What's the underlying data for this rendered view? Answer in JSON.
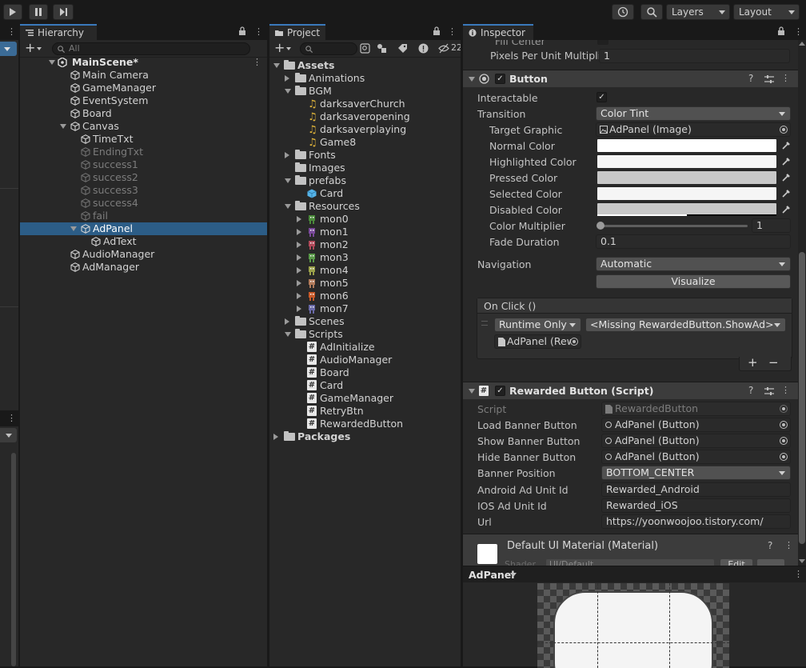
{
  "toolbar": {
    "layers_label": "Layers",
    "layout_label": "Layout"
  },
  "hierarchy": {
    "tab_label": "Hierarchy",
    "search_placeholder": "All",
    "scene_name": "MainScene*",
    "items": [
      {
        "label": "Main Camera",
        "depth": 1,
        "dim": false
      },
      {
        "label": "GameManager",
        "depth": 1,
        "dim": false
      },
      {
        "label": "EventSystem",
        "depth": 1,
        "dim": false
      },
      {
        "label": "Board",
        "depth": 1,
        "dim": false
      },
      {
        "label": "Canvas",
        "depth": 1,
        "dim": false
      },
      {
        "label": "TimeTxt",
        "depth": 2,
        "dim": false
      },
      {
        "label": "EndingTxt",
        "depth": 2,
        "dim": true
      },
      {
        "label": "success1",
        "depth": 2,
        "dim": true
      },
      {
        "label": "success2",
        "depth": 2,
        "dim": true
      },
      {
        "label": "success3",
        "depth": 2,
        "dim": true
      },
      {
        "label": "success4",
        "depth": 2,
        "dim": true
      },
      {
        "label": "fail",
        "depth": 2,
        "dim": true
      },
      {
        "label": "AdPanel",
        "depth": 2,
        "dim": false
      },
      {
        "label": "AdText",
        "depth": 3,
        "dim": false
      },
      {
        "label": "AudioManager",
        "depth": 1,
        "dim": false
      },
      {
        "label": "AdManager",
        "depth": 1,
        "dim": false
      }
    ]
  },
  "project": {
    "tab_label": "Project",
    "hidden_count": "22",
    "items": [
      {
        "label": "Assets",
        "kind": "root"
      },
      {
        "label": "Animations",
        "kind": "folder"
      },
      {
        "label": "BGM",
        "kind": "folder"
      },
      {
        "label": "darksaverChurch",
        "kind": "audio"
      },
      {
        "label": "darksaveropening",
        "kind": "audio"
      },
      {
        "label": "darksaverplaying",
        "kind": "audio"
      },
      {
        "label": "Game8",
        "kind": "audio"
      },
      {
        "label": "Fonts",
        "kind": "folder"
      },
      {
        "label": "Images",
        "kind": "folder"
      },
      {
        "label": "prefabs",
        "kind": "folder"
      },
      {
        "label": "Card",
        "kind": "prefab"
      },
      {
        "label": "Resources",
        "kind": "folder"
      },
      {
        "label": "mon0",
        "kind": "sprite"
      },
      {
        "label": "mon1",
        "kind": "sprite"
      },
      {
        "label": "mon2",
        "kind": "sprite"
      },
      {
        "label": "mon3",
        "kind": "sprite"
      },
      {
        "label": "mon4",
        "kind": "sprite"
      },
      {
        "label": "mon5",
        "kind": "sprite"
      },
      {
        "label": "mon6",
        "kind": "sprite"
      },
      {
        "label": "mon7",
        "kind": "sprite"
      },
      {
        "label": "Scenes",
        "kind": "folder"
      },
      {
        "label": "Scripts",
        "kind": "folder"
      },
      {
        "label": "AdInitialize",
        "kind": "script"
      },
      {
        "label": "AudioManager",
        "kind": "script"
      },
      {
        "label": "Board",
        "kind": "script"
      },
      {
        "label": "Card",
        "kind": "script"
      },
      {
        "label": "GameManager",
        "kind": "script"
      },
      {
        "label": "RetryBtn",
        "kind": "script"
      },
      {
        "label": "RewardedButton",
        "kind": "script"
      },
      {
        "label": "Packages",
        "kind": "root"
      }
    ]
  },
  "inspector": {
    "tab_label": "Inspector",
    "cut_label": "Fill Center",
    "pixels_per_unit_label": "Pixels Per Unit Multiplie",
    "pixels_per_unit_value": "1",
    "button": {
      "title": "Button",
      "interactable_label": "Interactable",
      "transition_label": "Transition",
      "transition_value": "Color Tint",
      "target_graphic_label": "Target Graphic",
      "target_graphic_value": "AdPanel (Image)",
      "normal_color_label": "Normal Color",
      "highlighted_color_label": "Highlighted Color",
      "pressed_color_label": "Pressed Color",
      "selected_color_label": "Selected Color",
      "disabled_color_label": "Disabled Color",
      "color_multiplier_label": "Color Multiplier",
      "color_multiplier_value": "1",
      "fade_duration_label": "Fade Duration",
      "fade_duration_value": "0.1",
      "navigation_label": "Navigation",
      "navigation_value": "Automatic",
      "visualize_label": "Visualize",
      "onclick_label": "On Click ()",
      "runtime_value": "Runtime Only",
      "method_value": "<Missing RewardedButton.ShowAd>",
      "object_value": "AdPanel (Rew",
      "plus_label": "+",
      "minus_label": "−"
    },
    "rewarded": {
      "title": "Rewarded Button (Script)",
      "script_label": "Script",
      "script_value": "RewardedButton",
      "load_banner_label": "Load Banner Button",
      "load_banner_value": "AdPanel (Button)",
      "show_banner_label": "Show Banner Button",
      "show_banner_value": "AdPanel (Button)",
      "hide_banner_label": "Hide Banner Button",
      "hide_banner_value": "AdPanel (Button)",
      "banner_position_label": "Banner Position",
      "banner_position_value": "BOTTOM_CENTER",
      "android_label": "Android Ad Unit Id",
      "android_value": "Rewarded_Android",
      "ios_label": "IOS Ad Unit Id",
      "ios_value": "Rewarded_iOS",
      "url_label": "Url",
      "url_value": "https://yoonwoojoo.tistory.com/"
    },
    "material": {
      "title": "Default UI Material (Material)",
      "shader_label": "Shader",
      "shader_value": "UI/Default",
      "edit_label": "Edit"
    },
    "preview": {
      "title": "AdPanel"
    }
  },
  "colors": {
    "selection": "#2c5d87",
    "accent_tab": "#3a79bb",
    "panel_bg": "#282828",
    "normal_color": "#ffffff",
    "highlighted_color": "#f5f5f5",
    "pressed_color": "#c8c8c8",
    "selected_color": "#f5f5f5",
    "disabled_color": "#c8c8c8"
  }
}
